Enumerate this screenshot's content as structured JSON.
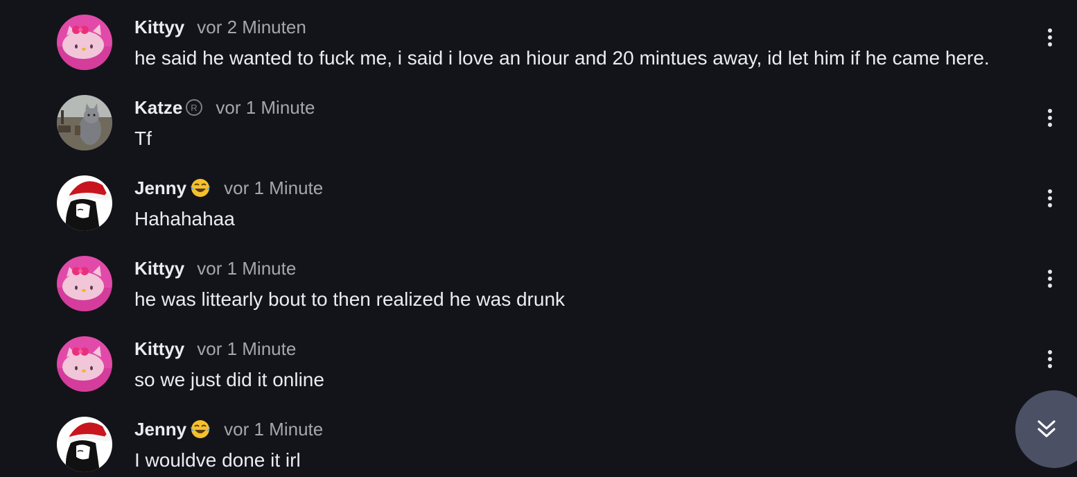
{
  "messages": [
    {
      "username": "Kittyy",
      "badge": "",
      "time": "vor 2 Minuten",
      "text": "he said he wanted to fuck me, i said i love an hiour and 20 mintues away, id let him if he came here.",
      "avatar": "hello-kitty-avatar"
    },
    {
      "username": "Katze",
      "badge": "registered-icon",
      "time": "vor 1 Minute",
      "text": "Tf",
      "avatar": "cat-photo-avatar"
    },
    {
      "username": "Jenny",
      "badge": "laughing-emoji",
      "time": "vor 1 Minute",
      "text": "Hahahahaa",
      "avatar": "santa-hat-girl-avatar"
    },
    {
      "username": "Kittyy",
      "badge": "",
      "time": "vor 1 Minute",
      "text": "he was littearly bout to then realized he was drunk",
      "avatar": "hello-kitty-avatar"
    },
    {
      "username": "Kittyy",
      "badge": "",
      "time": "vor 1 Minute",
      "text": "so we just did it online",
      "avatar": "hello-kitty-avatar"
    },
    {
      "username": "Jenny",
      "badge": "laughing-emoji",
      "time": "vor 1 Minute",
      "text": "I wouldve done it irl",
      "avatar": "santa-hat-girl-avatar"
    }
  ],
  "icons": {
    "more_options": "more-vertical-icon",
    "scroll_down": "double-chevron-down-icon"
  },
  "colors": {
    "background": "#131419",
    "text": "#ececf0",
    "timestamp": "#a6a7ae",
    "scroll_button": "#4b5064"
  }
}
